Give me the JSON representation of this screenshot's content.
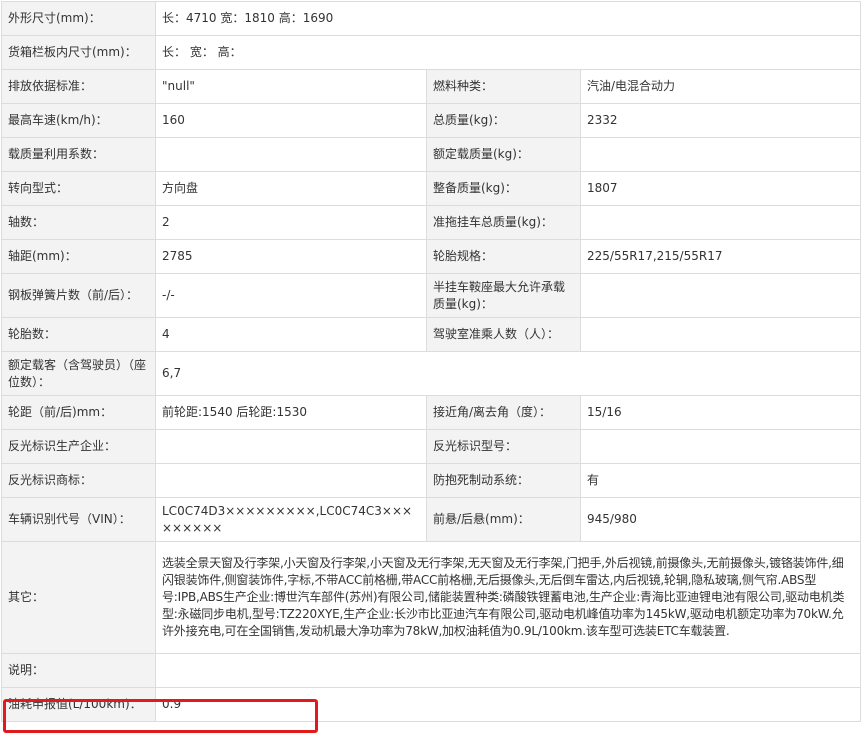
{
  "rows": [
    {
      "label": "外形尺寸(mm)：",
      "value": "长：4710 宽：1810 高：1690"
    },
    {
      "label": "货箱栏板内尺寸(mm)：",
      "value": "长： 宽： 高："
    },
    {
      "label": "排放依据标准：",
      "value": "\"null\"",
      "label2": "燃料种类：",
      "value2": "汽油/电混合动力"
    },
    {
      "label": "最高车速(km/h)：",
      "value": "160",
      "label2": "总质量(kg)：",
      "value2": "2332"
    },
    {
      "label": "载质量利用系数：",
      "value": "",
      "label2": "额定载质量(kg)：",
      "value2": ""
    },
    {
      "label": "转向型式：",
      "value": "方向盘",
      "label2": "整备质量(kg)：",
      "value2": "1807"
    },
    {
      "label": "轴数：",
      "value": "2",
      "label2": "准拖挂车总质量(kg)：",
      "value2": ""
    },
    {
      "label": "轴距(mm)：",
      "value": "2785",
      "label2": "轮胎规格：",
      "value2": "225/55R17,215/55R17"
    },
    {
      "label": "钢板弹簧片数（前/后）：",
      "value": "-/-",
      "label2": "半挂车鞍座最大允许承载质量(kg)：",
      "value2": ""
    },
    {
      "label": "轮胎数：",
      "value": "4",
      "label2": "驾驶室准乘人数（人）：",
      "value2": ""
    },
    {
      "label": "额定载客（含驾驶员）（座位数）：",
      "value": "6,7"
    },
    {
      "label": "轮距（前/后)mm：",
      "value": "前轮距:1540 后轮距:1530",
      "label2": "接近角/离去角（度）：",
      "value2": "15/16"
    },
    {
      "label": "反光标识生产企业：",
      "value": "",
      "label2": "反光标识型号：",
      "value2": ""
    },
    {
      "label": "反光标识商标：",
      "value": "",
      "label2": "防抱死制动系统：",
      "value2": "有"
    },
    {
      "label": "车辆识别代号（VIN）：",
      "value": "LC0C74D3×××××××××,LC0C74C3×××××××××",
      "label2": "前悬/后悬(mm)：",
      "value2": "945/980"
    },
    {
      "label": "其它：",
      "value": "选装全景天窗及行李架,小天窗及行李架,小天窗及无行李架,无天窗及无行李架,门把手,外后视镜,前摄像头,无前摄像头,镀铬装饰件,细闪银装饰件,侧窗装饰件,字标,不带ACC前格栅,带ACC前格栅,无后摄像头,无后倒车雷达,内后视镜,轮辋,隐私玻璃,侧气帘.ABS型号:IPB,ABS生产企业:博世汽车部件(苏州)有限公司,储能装置种类:磷酸铁锂蓄电池,生产企业:青海比亚迪锂电池有限公司,驱动电机类型:永磁同步电机,型号:TZ220XYE,生产企业:长沙市比亚迪汽车有限公司,驱动电机峰值功率为145kW,驱动电机额定功率为70kW.允许外接充电,可在全国销售,发动机最大净功率为78kW,加权油耗值为0.9L/100km.该车型可选装ETC车载装置."
    },
    {
      "label": "说明：",
      "value": ""
    },
    {
      "label": "油耗申报值(L/100km)：",
      "value": "0.9"
    }
  ],
  "colors": {
    "label_bg": "#f3f3f3",
    "border": "#dcdcdc",
    "highlight": "#e11b1b"
  }
}
